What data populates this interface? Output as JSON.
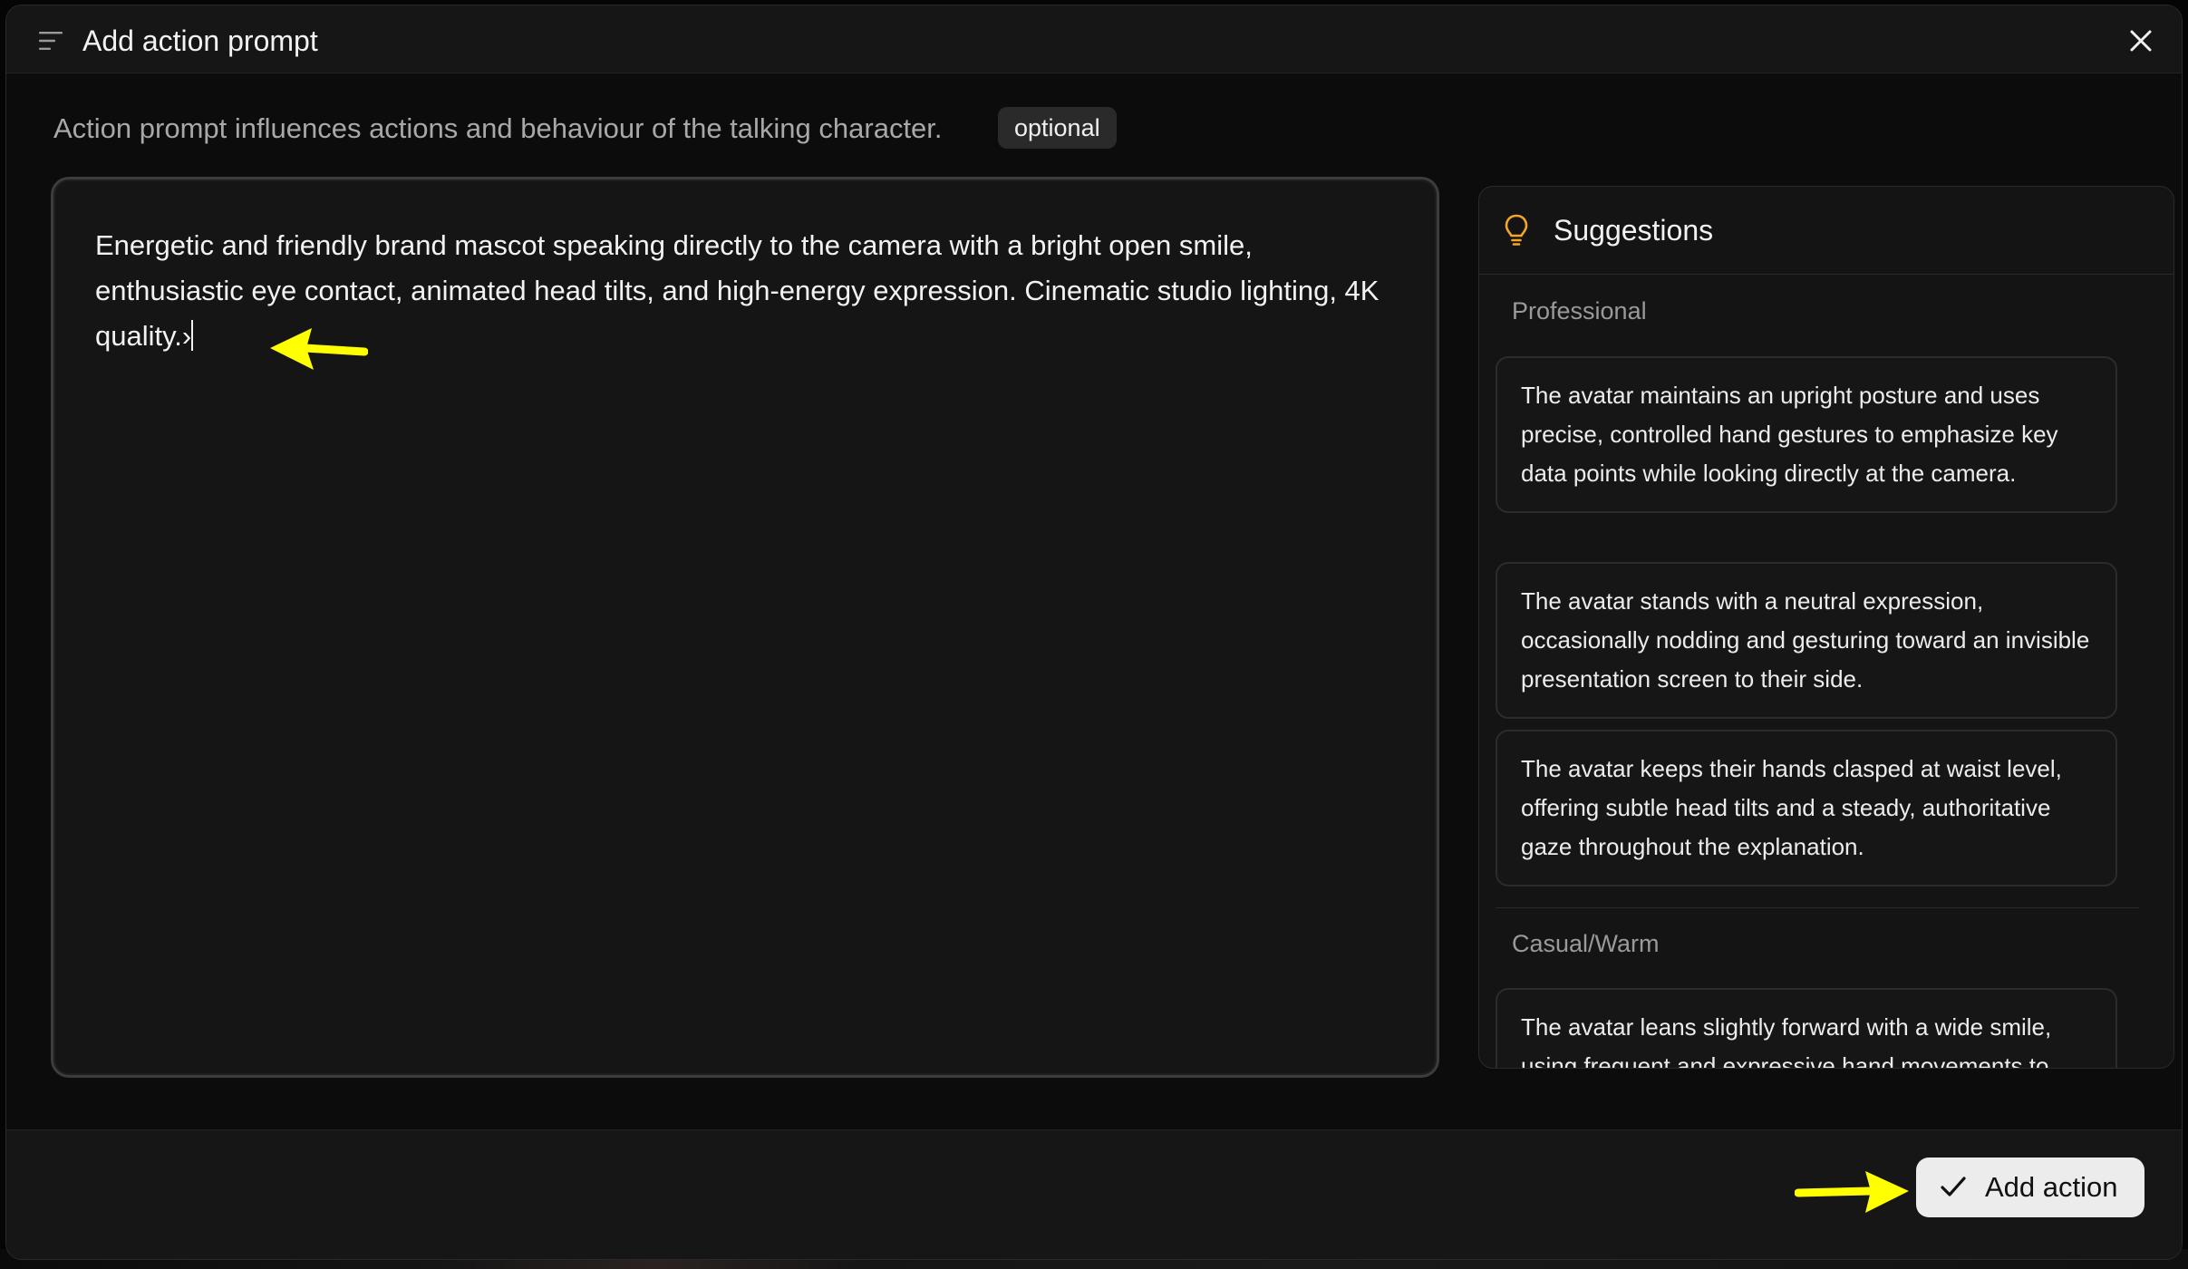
{
  "dialog": {
    "title": "Add action prompt",
    "description": "Action prompt influences actions and behaviour of the talking character.",
    "badge": "optional"
  },
  "editor": {
    "value": "Energetic and friendly brand mascot speaking directly to the camera with a bright open smile, enthusiastic eye contact, animated head tilts, and high-energy expression. Cinematic studio lighting, 4K quality.›"
  },
  "suggestions": {
    "title": "Suggestions",
    "groups": [
      {
        "label": "Professional",
        "items": [
          "The avatar maintains an upright posture and uses precise, controlled hand gestures to emphasize key data points while looking directly at the camera.",
          "The avatar stands with a neutral expression, occasionally nodding and gesturing toward an invisible presentation screen to their side.",
          "The avatar keeps their hands clasped at waist level, offering subtle head tilts and a steady, authoritative gaze throughout the explanation."
        ]
      },
      {
        "label": "Casual/Warm",
        "items": [
          "The avatar leans slightly forward with a wide smile, using frequent and expressive hand movements to"
        ]
      }
    ]
  },
  "footer": {
    "add_label": "Add action"
  },
  "colors": {
    "annotation_arrow": "#ffff00",
    "button_bg": "#ececec",
    "bulb": "#f5a623"
  },
  "icons": [
    "menu-icon",
    "close-icon",
    "lightbulb-icon",
    "check-icon",
    "arrow-annotation-icon"
  ]
}
